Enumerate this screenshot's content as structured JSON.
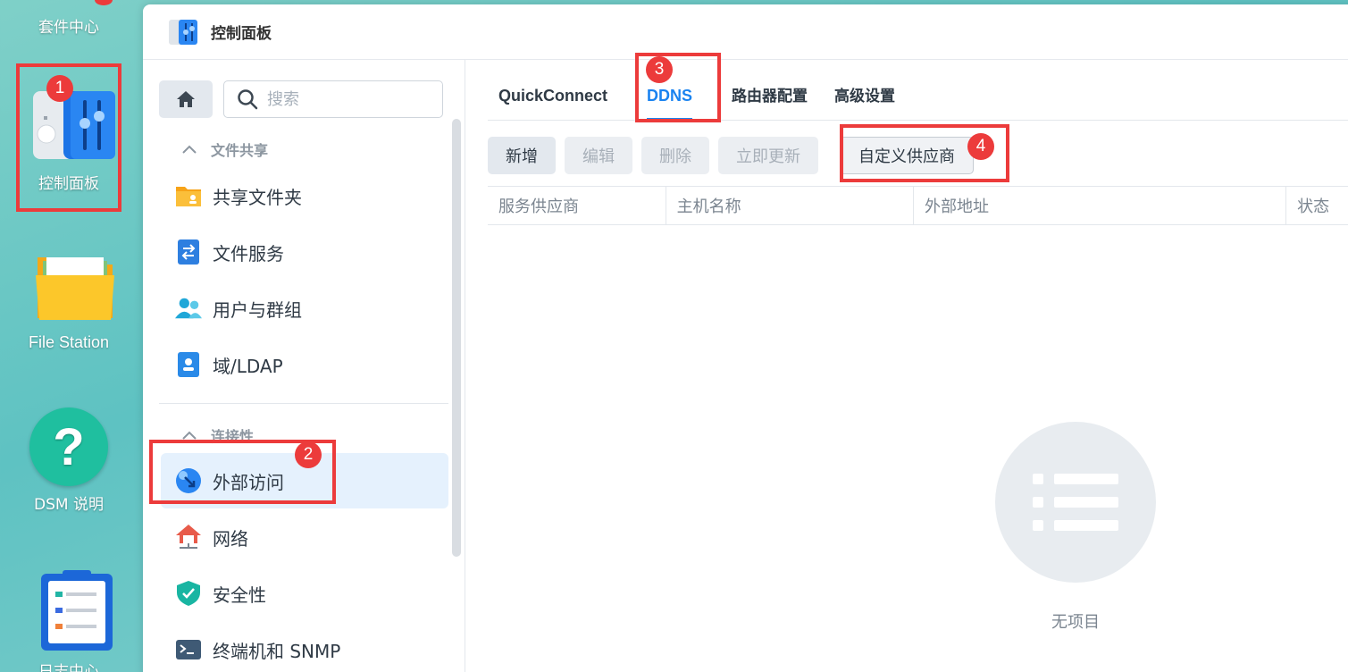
{
  "desktop": {
    "items": [
      {
        "label": "套件中心"
      },
      {
        "label": "控制面板"
      },
      {
        "label": "File Station"
      },
      {
        "label": "DSM 说明"
      },
      {
        "label": "日志中心"
      }
    ]
  },
  "window": {
    "title": "控制面板"
  },
  "sidebar": {
    "search_placeholder": "搜索",
    "groups": [
      {
        "label": "文件共享"
      },
      {
        "label": "连接性"
      }
    ],
    "items": [
      {
        "label": "共享文件夹"
      },
      {
        "label": "文件服务"
      },
      {
        "label": "用户与群组"
      },
      {
        "label": "域/LDAP"
      },
      {
        "label": "外部访问"
      },
      {
        "label": "网络"
      },
      {
        "label": "安全性"
      },
      {
        "label": "终端机和 SNMP"
      }
    ]
  },
  "tabs": [
    {
      "label": "QuickConnect"
    },
    {
      "label": "DDNS"
    },
    {
      "label": "路由器配置"
    },
    {
      "label": "高级设置"
    }
  ],
  "toolbar": {
    "add": "新增",
    "edit": "编辑",
    "delete": "删除",
    "update_now": "立即更新",
    "custom_provider": "自定义供应商"
  },
  "table": {
    "columns": [
      "服务供应商",
      "主机名称",
      "外部地址",
      "状态"
    ]
  },
  "empty_state": {
    "text": "无项目"
  },
  "annotations": [
    "1",
    "2",
    "3",
    "4"
  ],
  "colors": {
    "accent": "#1a83f0",
    "highlight": "#ec3b3b"
  }
}
